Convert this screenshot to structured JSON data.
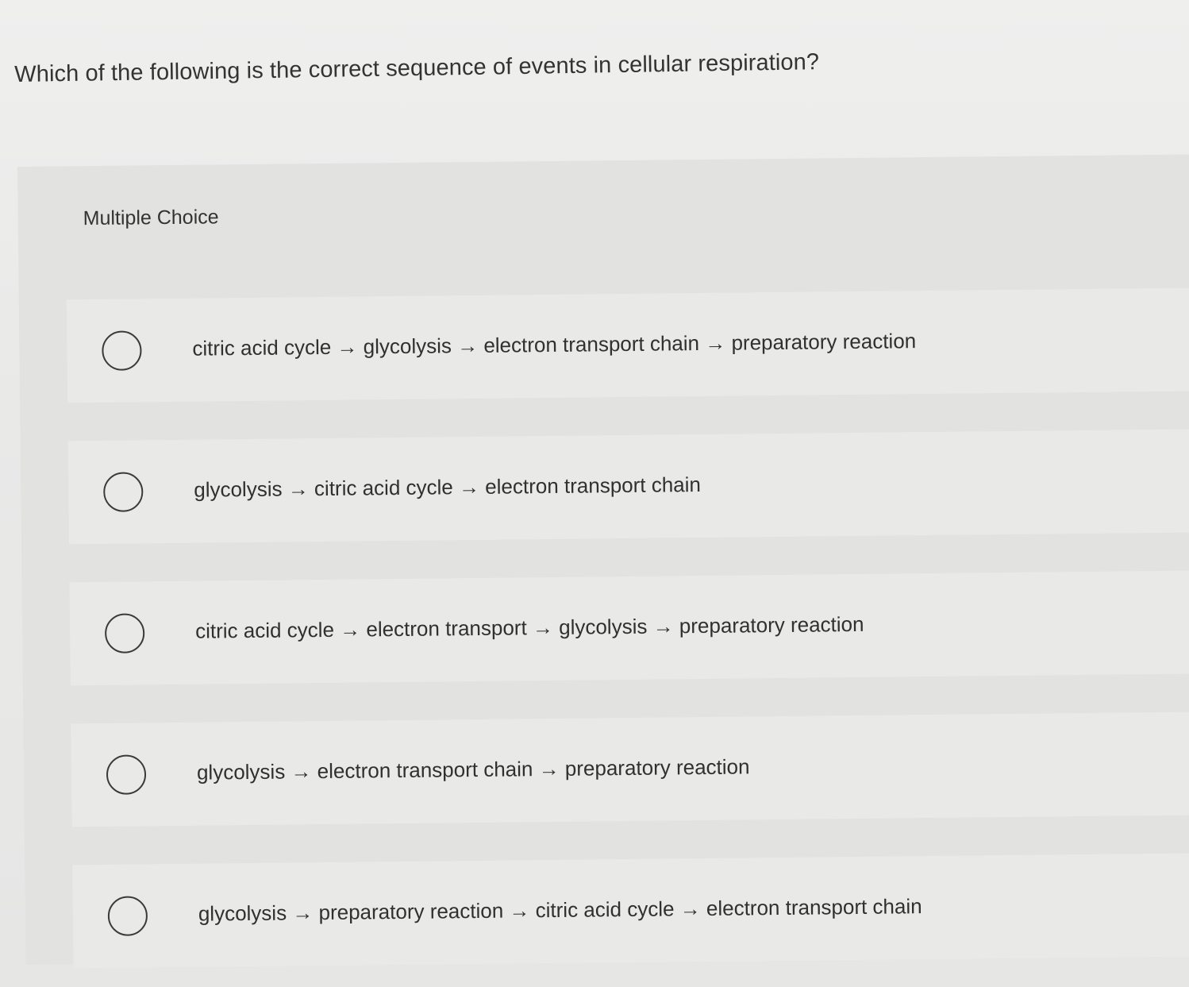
{
  "question": {
    "text": "Which of the following is the correct sequence of events in cellular respiration?"
  },
  "panel": {
    "title": "Multiple Choice"
  },
  "options": [
    {
      "label": "citric acid cycle → glycolysis → electron transport chain → preparatory reaction",
      "selected": false
    },
    {
      "label": "glycolysis → citric acid cycle → electron transport chain",
      "selected": false
    },
    {
      "label": "citric acid cycle → electron transport → glycolysis → preparatory reaction",
      "selected": false
    },
    {
      "label": "glycolysis → electron transport chain → preparatory reaction",
      "selected": false
    },
    {
      "label": "glycolysis → preparatory reaction → citric acid cycle → electron transport chain",
      "selected": false
    }
  ]
}
